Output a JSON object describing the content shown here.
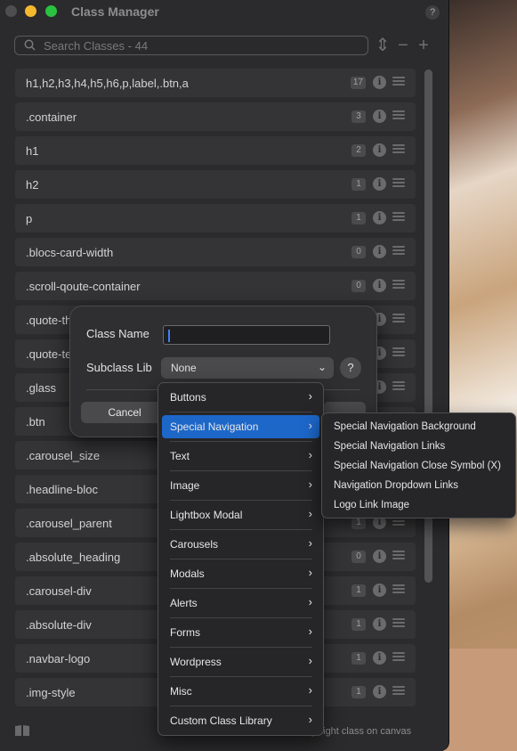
{
  "window": {
    "title": "Class Manager",
    "help_label": "?",
    "search_placeholder": "Search Classes - 44",
    "tool_sort": "⇕",
    "tool_remove": "−",
    "tool_add": "+"
  },
  "classes": [
    {
      "label": "h1,h2,h3,h4,h5,h6,p,label,.btn,a",
      "count": "17"
    },
    {
      "label": ".container",
      "count": "3"
    },
    {
      "label": "h1",
      "count": "2"
    },
    {
      "label": "h2",
      "count": "1"
    },
    {
      "label": "p",
      "count": "1"
    },
    {
      "label": ".blocs-card-width",
      "count": "0"
    },
    {
      "label": ".scroll-qoute-container",
      "count": "0"
    },
    {
      "label": ".quote-th",
      "count": ""
    },
    {
      "label": ".quote-te",
      "count": ""
    },
    {
      "label": ".glass",
      "count": ""
    },
    {
      "label": ".btn",
      "count": ""
    },
    {
      "label": ".carousel_size",
      "count": ""
    },
    {
      "label": ".headline-bloc",
      "count": ""
    },
    {
      "label": ".carousel_parent",
      "count": "1"
    },
    {
      "label": ".absolute_heading",
      "count": "0"
    },
    {
      "label": ".carousel-div",
      "count": "1"
    },
    {
      "label": ".absolute-div",
      "count": "1"
    },
    {
      "label": ".navbar-logo",
      "count": "1"
    },
    {
      "label": ".img-style",
      "count": "1"
    }
  ],
  "footer": {
    "text": "ighlight class on canvas"
  },
  "dialog": {
    "class_name_label": "Class Name",
    "class_name_value": "",
    "subclass_lib_label": "Subclass Lib",
    "subclass_lib_value": "None",
    "chevron": "⌄",
    "help_label": "?",
    "cancel_label": "Cancel"
  },
  "menu": {
    "items": [
      {
        "label": "Buttons",
        "arrow": "›"
      },
      {
        "label": "Special Navigation",
        "arrow": "›"
      },
      {
        "label": "Text",
        "arrow": "›"
      },
      {
        "label": "Image",
        "arrow": "›"
      },
      {
        "label": "Lightbox Modal",
        "arrow": "›"
      },
      {
        "label": "Carousels",
        "arrow": "›"
      },
      {
        "label": "Modals",
        "arrow": "›"
      },
      {
        "label": "Alerts",
        "arrow": "›"
      },
      {
        "label": "Forms",
        "arrow": "›"
      },
      {
        "label": "Wordpress",
        "arrow": "›"
      },
      {
        "label": "Misc",
        "arrow": "›"
      },
      {
        "label": "Custom Class Library",
        "arrow": "›"
      }
    ],
    "active": "Special Navigation"
  },
  "submenu": {
    "items": [
      "Special Navigation Background",
      "Special Navigation Links",
      "Special Navigation Close Symbol (X)",
      "Navigation Dropdown Links",
      "Logo Link Image"
    ]
  },
  "colors": {
    "accent": "#1d67c9",
    "window_bg": "#2b2b2d",
    "traffic_min": "#f5b82e",
    "traffic_max": "#29c240"
  }
}
